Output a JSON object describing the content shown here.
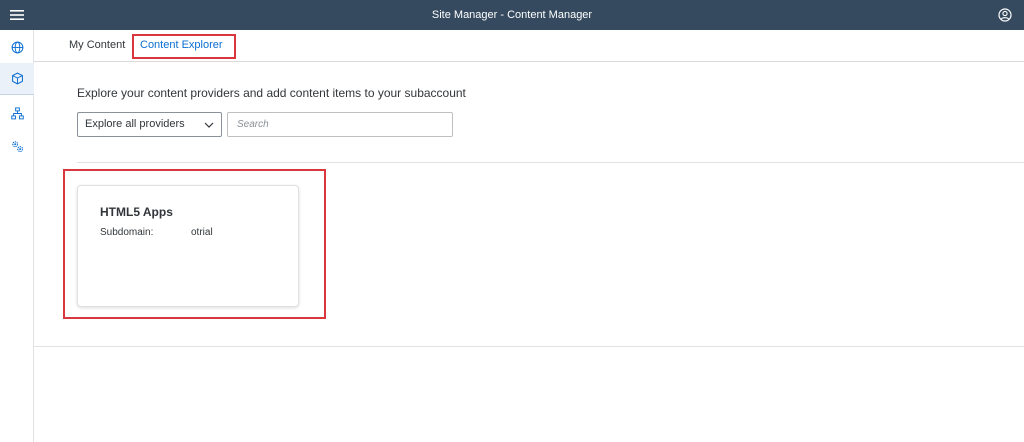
{
  "header": {
    "title": "Site Manager - Content Manager",
    "menu_icon": "hamburger-menu-icon",
    "user_icon": "user-profile-icon",
    "bg_color": "#354a5f"
  },
  "sidenav": {
    "items": [
      {
        "icon": "globe-icon",
        "active": false
      },
      {
        "icon": "package-icon",
        "active": true
      },
      {
        "icon": "site-hierarchy-icon",
        "active": false
      },
      {
        "icon": "settings-gears-icon",
        "active": false
      }
    ]
  },
  "tabs": [
    {
      "label": "My Content",
      "selected": false
    },
    {
      "label": "Content Explorer",
      "selected": true
    }
  ],
  "intro_text": "Explore your content providers and add content items to your subaccount",
  "provider_select": {
    "value": "Explore all providers",
    "icon": "chevron-down-icon"
  },
  "search": {
    "placeholder": "Search",
    "value": ""
  },
  "cards": [
    {
      "title": "HTML5 Apps",
      "subdomain_label": "Subdomain:",
      "subdomain_value": "otrial"
    }
  ],
  "colors": {
    "accent": "#0a6ed1",
    "highlight": "#d9363e"
  }
}
